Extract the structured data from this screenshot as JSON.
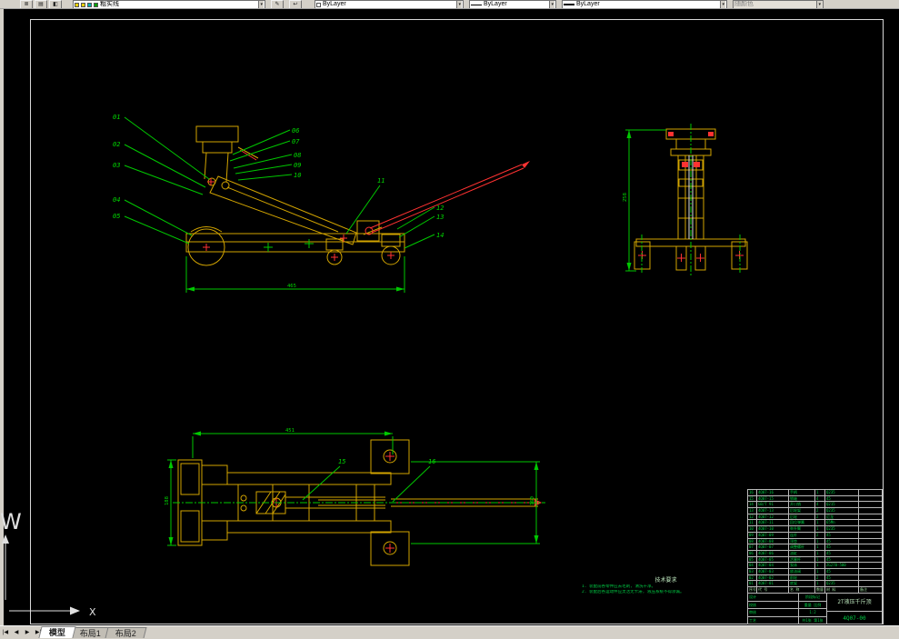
{
  "toolbar": {
    "layer_combo": "粗实线",
    "color_combo": "ByLayer",
    "linetype_combo": "ByLayer",
    "lineweight_combo": "ByLayer",
    "plotstyle_combo": "随颜色"
  },
  "icons": {
    "dropdown": "▾",
    "layers": "▤",
    "layer_manager": "≣",
    "color_wheel": "◧",
    "make_current": "✎",
    "prev_layer": "↩",
    "nav_first": "|◀",
    "nav_prev": "◀",
    "nav_next": "▶",
    "nav_last": "▶|"
  },
  "tabs": {
    "model": "模型",
    "layout1": "布局1",
    "layout2": "布局2"
  },
  "axis": {
    "ucs_label": "W",
    "x_label": "X"
  },
  "part_labels": [
    "01",
    "02",
    "03",
    "04",
    "05",
    "06",
    "07",
    "08",
    "09",
    "10",
    "11",
    "12",
    "13",
    "14",
    "15",
    "16"
  ],
  "dims": {
    "side_width": "465",
    "front_height": "258",
    "top_width": "451",
    "top_left_height": "188",
    "top_right_height": "160"
  },
  "notes": {
    "title": "技术要求",
    "lines": [
      "1. 装配前各零件应去毛刺, 清洗干净。",
      "2. 装配后各运动件应灵活无卡滞, 液压系统不得渗漏。"
    ]
  },
  "parts_table": {
    "header": [
      "序号",
      "代  号",
      "名  称",
      "数量",
      "材  料",
      "备注"
    ],
    "rows": [
      [
        "16",
        "4Q07-16",
        "手柄",
        "1",
        "Q235",
        ""
      ],
      [
        "15",
        "4Q07-15",
        "销轴",
        "4",
        "45",
        ""
      ],
      [
        "14",
        "GB/T 91",
        "开口销",
        "4",
        "Q215",
        ""
      ],
      [
        "13",
        "4Q07-13",
        "后轮架",
        "2",
        "Q235",
        ""
      ],
      [
        "12",
        "4Q07-12",
        "后轮",
        "2",
        "尼龙",
        ""
      ],
      [
        "11",
        "4Q07-11",
        "回位弹簧",
        "1",
        "65Mn",
        ""
      ],
      [
        "10",
        "4Q07-10",
        "举升臂",
        "1",
        "Q235",
        ""
      ],
      [
        "09",
        "4Q07-09",
        "连杆",
        "2",
        "45",
        ""
      ],
      [
        "08",
        "4Q07-08",
        "顶垫",
        "1",
        "45",
        ""
      ],
      [
        "07",
        "4Q07-07",
        "调整螺杆",
        "1",
        "45",
        ""
      ],
      [
        "06",
        "4Q07-06",
        "油缸",
        "1",
        "45",
        ""
      ],
      [
        "05",
        "4Q07-05",
        "活塞杆",
        "1",
        "45",
        ""
      ],
      [
        "04",
        "4Q07-04",
        "泵体",
        "1",
        "ZG270-500",
        ""
      ],
      [
        "03",
        "4Q07-03",
        "放油阀",
        "1",
        "45",
        ""
      ],
      [
        "02",
        "4Q07-02",
        "前轮",
        "2",
        "45",
        ""
      ],
      [
        "01",
        "4Q07-01",
        "底架",
        "1",
        "Q235",
        ""
      ]
    ]
  },
  "title_block": {
    "title": "2T液压千斤顶",
    "drawing_no": "4Q07-00",
    "rows": [
      "设计",
      "校核",
      "审核",
      "工艺"
    ],
    "mid_cells": [
      "阶段标记",
      "重量  比例",
      "1:2",
      "共1张 第1张"
    ]
  }
}
